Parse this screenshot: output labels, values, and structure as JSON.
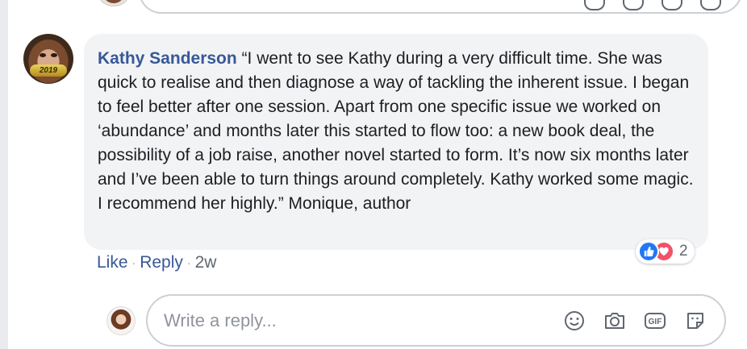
{
  "comment": {
    "author": "Kathy Sanderson",
    "text": "“I went to see Kathy during a very difficult time. She was quick to realise and then diagnose a way of tackling the inherent issue. I began to feel better after one session. Apart from one specific issue we worked on ‘abundance’ and months later this started to flow too: a new book deal, the possibility of a job raise, another novel started to form. It’s now six months later and I’ve been able to turn things around completely. Kathy worked some magic. I recommend her highly.” Monique, author",
    "avatar_badge": "2019",
    "reactions": {
      "icons": [
        "like-icon",
        "love-icon"
      ],
      "count": "2"
    },
    "actions": {
      "like": "Like",
      "reply": "Reply",
      "time": "2w",
      "separator": "·"
    }
  },
  "reply_box": {
    "placeholder": "Write a reply...",
    "icons": [
      "emoji-icon",
      "camera-icon",
      "gif-icon",
      "sticker-icon"
    ]
  },
  "colors": {
    "author_link": "#385898",
    "bubble_bg": "#f2f3f5",
    "like_blue": "#2078f4",
    "love_red": "#f25268"
  }
}
